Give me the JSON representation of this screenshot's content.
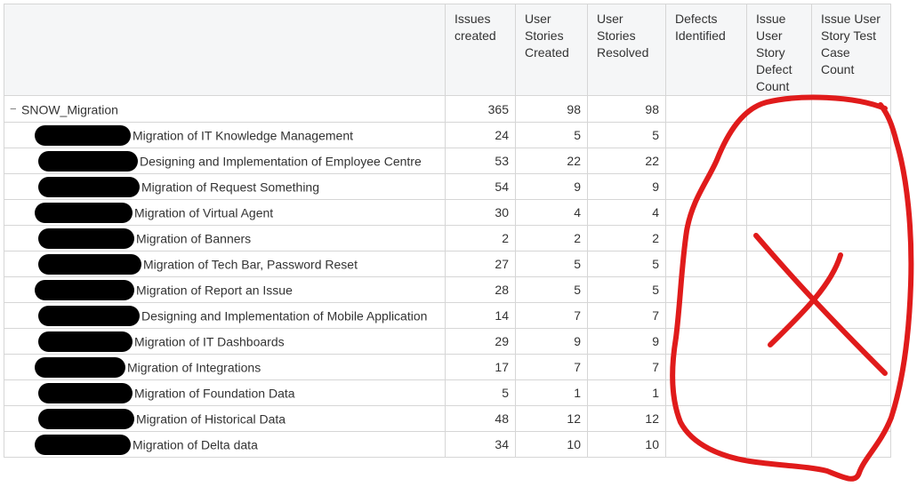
{
  "columns": [
    {
      "label": "Issues created"
    },
    {
      "label": "User Stories Created"
    },
    {
      "label": "User Stories Resolved"
    },
    {
      "label": "Defects Identified"
    },
    {
      "label": "Issue User Story Defect Count"
    },
    {
      "label": "Issue User Story Test Case Count"
    }
  ],
  "group": {
    "label": "SNOW_Migration",
    "collapse_icon": "minus-icon",
    "values": [
      "365",
      "98",
      "98",
      "",
      "",
      ""
    ]
  },
  "rows": [
    {
      "label": "Migration of IT Knowledge Management",
      "values": [
        "24",
        "5",
        "5",
        "",
        "",
        ""
      ]
    },
    {
      "label": "Designing and Implementation of Employee Centre",
      "values": [
        "53",
        "22",
        "22",
        "",
        "",
        ""
      ]
    },
    {
      "label": "Migration of Request Something",
      "values": [
        "54",
        "9",
        "9",
        "",
        "",
        ""
      ]
    },
    {
      "label": "Migration of Virtual Agent",
      "values": [
        "30",
        "4",
        "4",
        "",
        "",
        ""
      ]
    },
    {
      "label": "Migration of Banners",
      "values": [
        "2",
        "2",
        "2",
        "",
        "",
        ""
      ]
    },
    {
      "label": "Migration of Tech Bar, Password Reset",
      "values": [
        "27",
        "5",
        "5",
        "",
        "",
        ""
      ]
    },
    {
      "label": "Migration of Report an Issue",
      "values": [
        "28",
        "5",
        "5",
        "",
        "",
        ""
      ]
    },
    {
      "label": "Designing and Implementation of Mobile Application",
      "values": [
        "14",
        "7",
        "7",
        "",
        "",
        ""
      ]
    },
    {
      "label": "Migration of IT Dashboards",
      "values": [
        "29",
        "9",
        "9",
        "",
        "",
        ""
      ]
    },
    {
      "label": "Migration of Integrations",
      "values": [
        "17",
        "7",
        "7",
        "",
        "",
        ""
      ]
    },
    {
      "label": "Migration of Foundation Data",
      "values": [
        "5",
        "1",
        "1",
        "",
        "",
        ""
      ]
    },
    {
      "label": "Migration of Historical Data",
      "values": [
        "48",
        "12",
        "12",
        "",
        "",
        ""
      ]
    },
    {
      "label": "Migration of Delta data",
      "values": [
        "34",
        "10",
        "10",
        "",
        "",
        ""
      ]
    }
  ],
  "colors": {
    "annotation": "#e01b1b",
    "redaction": "#000000",
    "header_bg": "#f5f6f7",
    "grid": "#d6d6d6"
  }
}
